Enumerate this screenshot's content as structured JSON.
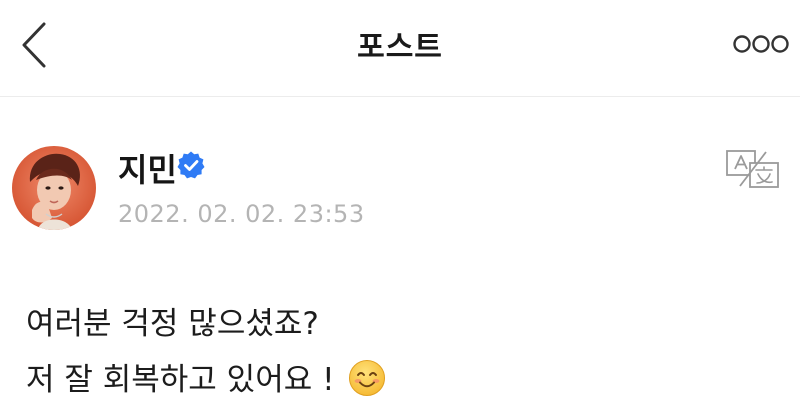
{
  "header": {
    "title": "포스트",
    "back_icon": "chevron-left-icon",
    "more_icon": "more-options-icon"
  },
  "post": {
    "author": {
      "name": "지민",
      "verified": true,
      "verified_icon": "verified-badge-icon",
      "verified_color": "#2f7bf5"
    },
    "timestamp": "2022. 02. 02. 23:53",
    "translate_icon": "translate-icon",
    "body_lines": [
      "여러분 걱정 많으셨죠?",
      "저 잘 회복하고 있어요 !"
    ],
    "emoji_icon": "smiling-face-emoji-icon"
  }
}
